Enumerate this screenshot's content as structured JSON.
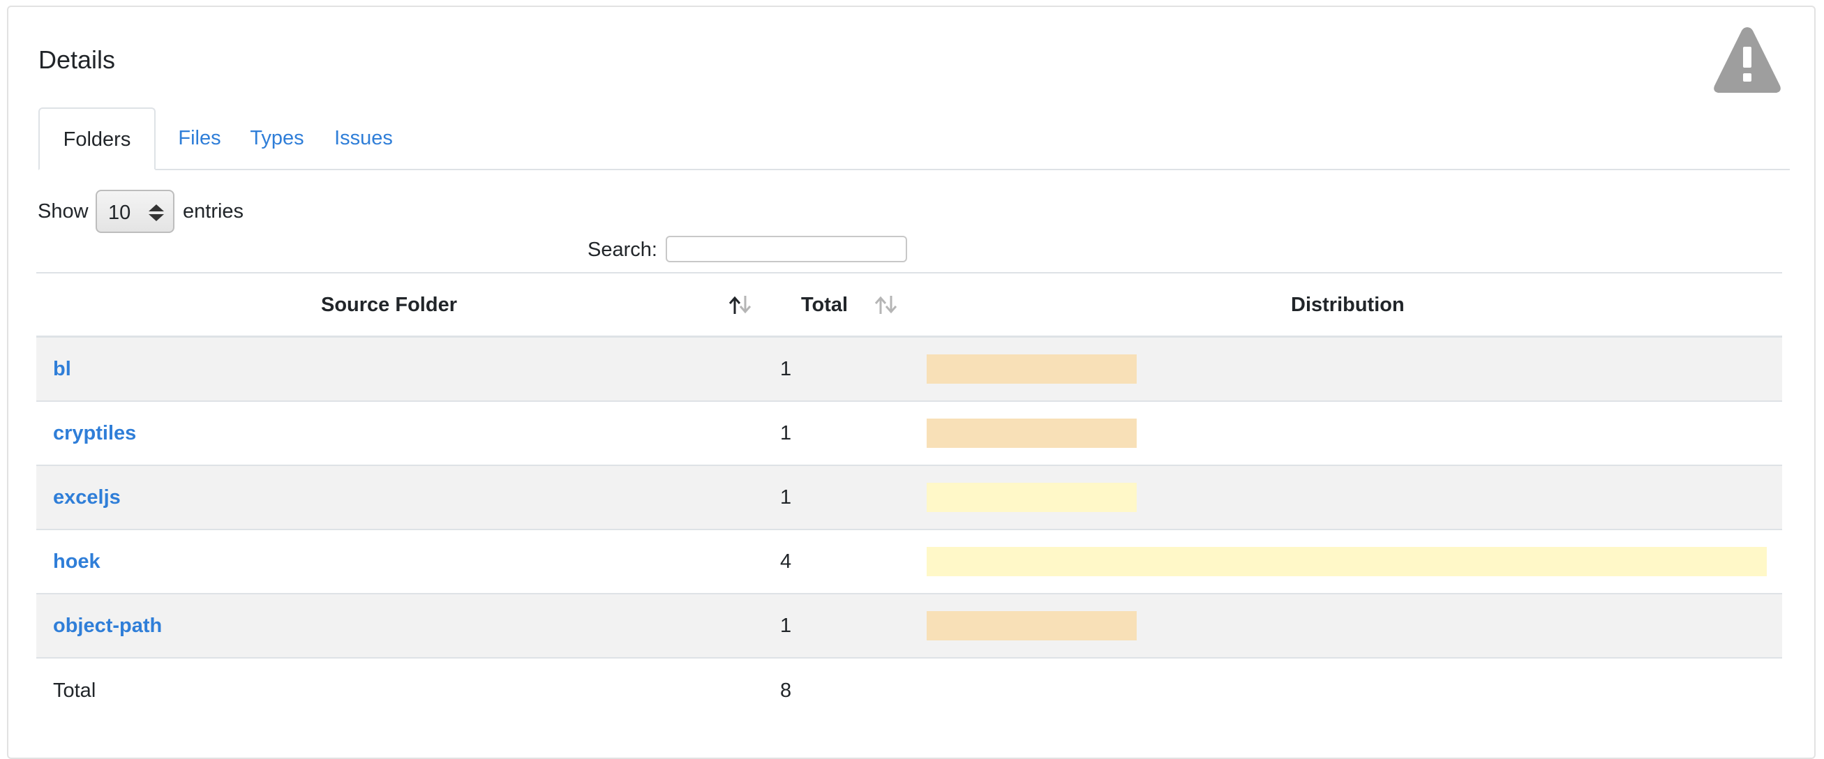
{
  "header": {
    "title": "Details",
    "warning_icon": "warning-triangle-icon"
  },
  "tabs": [
    {
      "label": "Folders",
      "active": true
    },
    {
      "label": "Files",
      "active": false
    },
    {
      "label": "Types",
      "active": false
    },
    {
      "label": "Issues",
      "active": false
    }
  ],
  "controls": {
    "show_label": "Show",
    "entries_value": "10",
    "entries_label": "entries",
    "search_label": "Search:",
    "search_value": ""
  },
  "table": {
    "columns": [
      "Source Folder",
      "Total",
      "Distribution"
    ],
    "rows": [
      {
        "folder": "bl",
        "total": "1",
        "distribution": 0.25,
        "color": "#f8e0b7"
      },
      {
        "folder": "cryptiles",
        "total": "1",
        "distribution": 0.25,
        "color": "#f8e0b7"
      },
      {
        "folder": "exceljs",
        "total": "1",
        "distribution": 0.25,
        "color": "#fff8c8"
      },
      {
        "folder": "hoek",
        "total": "4",
        "distribution": 1.0,
        "color": "#fff8c8"
      },
      {
        "folder": "object-path",
        "total": "1",
        "distribution": 0.25,
        "color": "#f8e0b7"
      }
    ],
    "footer": {
      "label": "Total",
      "value": "8"
    }
  },
  "colors": {
    "link": "#2f7ed8",
    "stripe": "#f2f2f2",
    "warning_icon": "#9e9e9e"
  }
}
